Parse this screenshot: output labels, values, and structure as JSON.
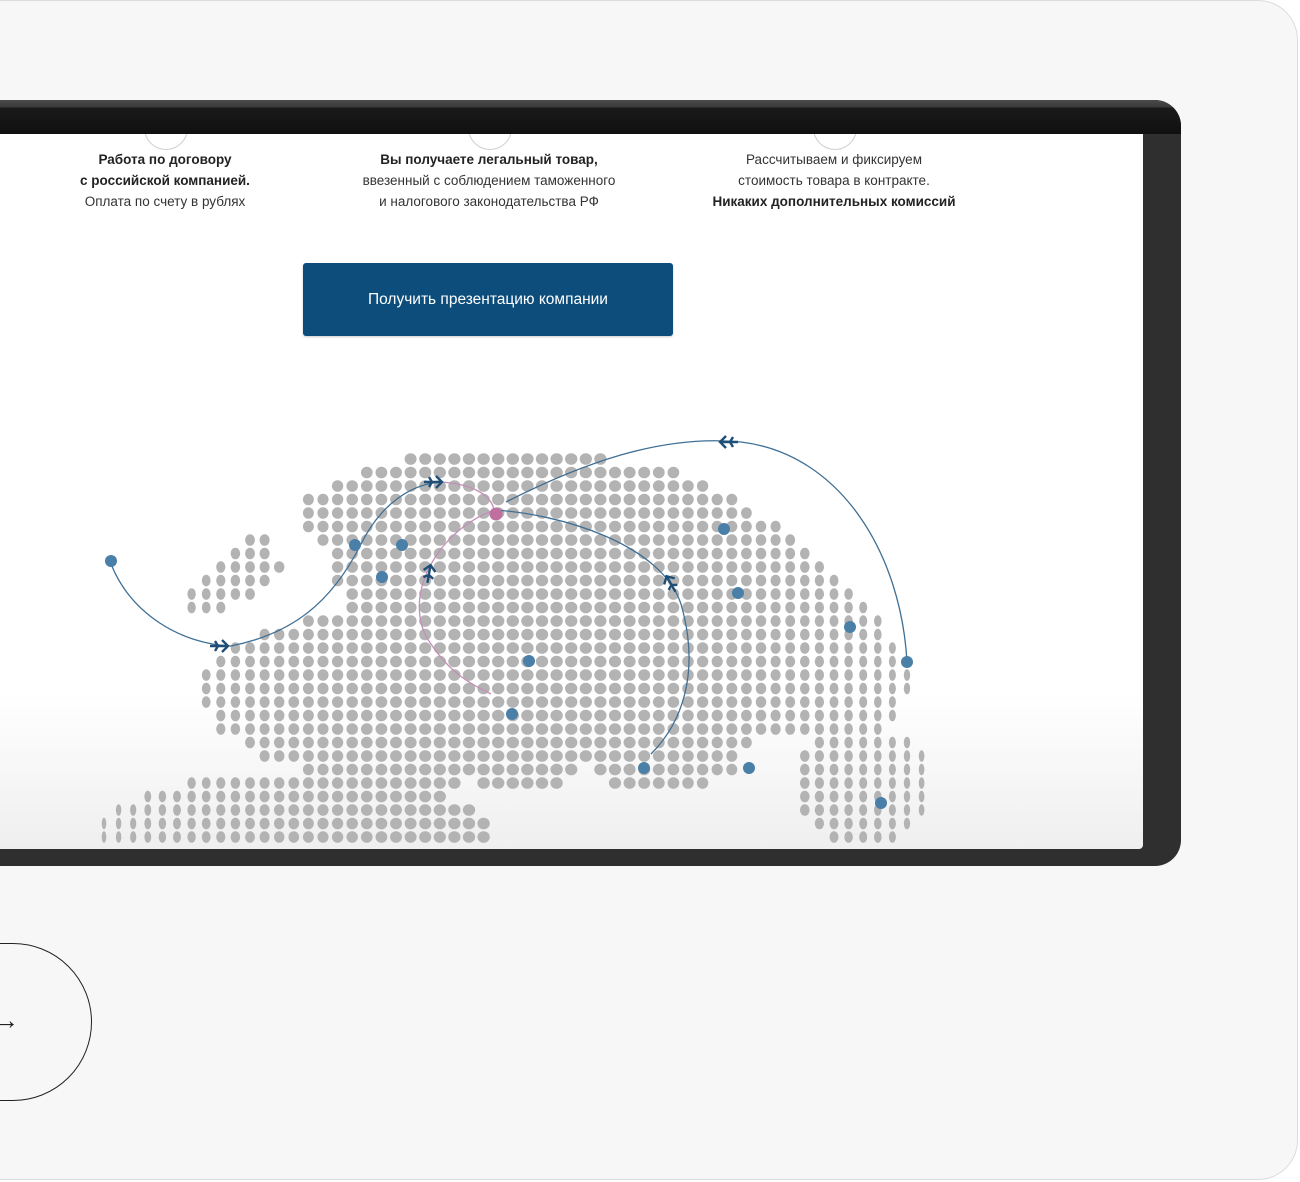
{
  "features": [
    {
      "lines": [
        {
          "text": "Работа по договору",
          "bold": true
        },
        {
          "text": "с российской компанией.",
          "bold": true
        },
        {
          "text": "Оплата по счету в рублях",
          "bold": false
        }
      ]
    },
    {
      "lines": [
        {
          "text": "Вы получаете легальный товар,",
          "bold": true
        },
        {
          "text": "ввезенный с соблюдением таможенного",
          "bold": false
        },
        {
          "text": "и налогового законодательства РФ",
          "bold": false
        }
      ]
    },
    {
      "lines": [
        {
          "text": "Рассчитываем и фиксируем",
          "bold": false
        },
        {
          "text": "стоимость товара в контракте.",
          "bold": false
        },
        {
          "text": "Никаких дополнительных комиссий",
          "bold": true
        }
      ]
    }
  ],
  "cta": {
    "label": "Получить презентацию компании"
  },
  "more_button": {
    "label": "ее →"
  },
  "map": {
    "colors": {
      "dot": "#b3b3b3",
      "city": "#4a7fa8",
      "hub": "#c070a0",
      "route": "#3f6f94",
      "route_pink": "#c58fb8",
      "plane": "#1f4f77"
    }
  }
}
